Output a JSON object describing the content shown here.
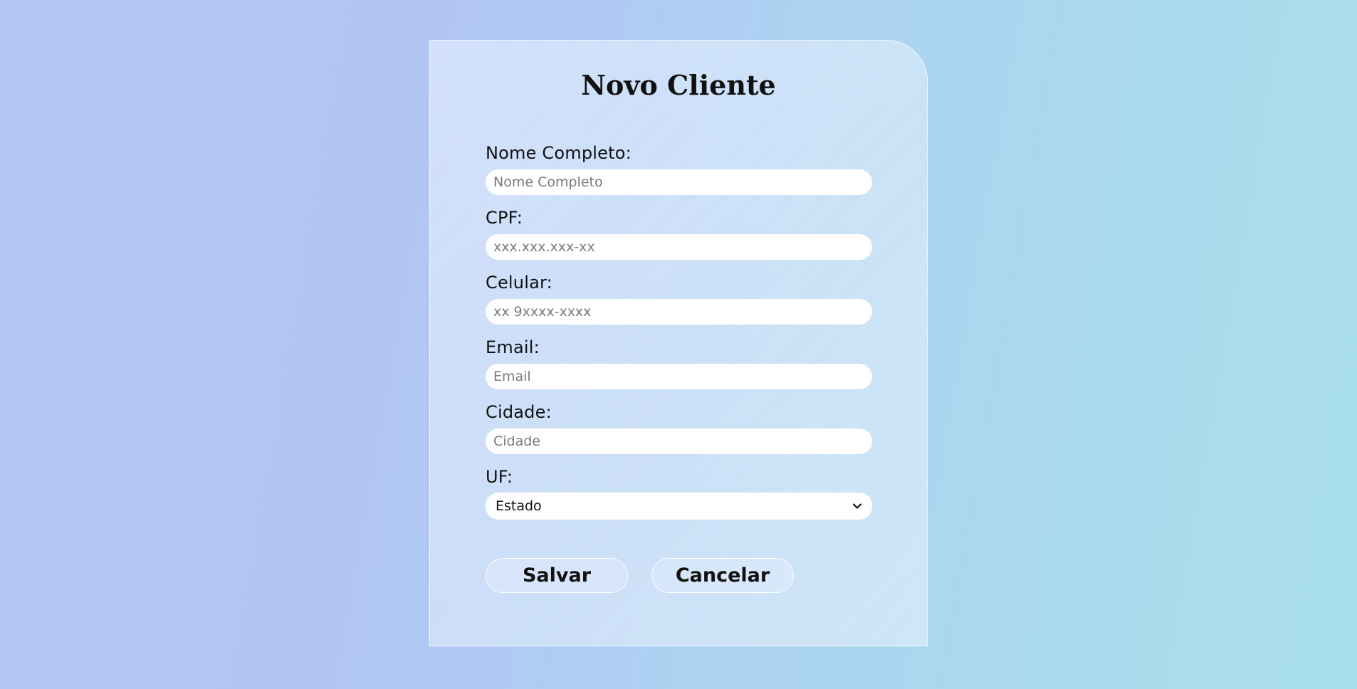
{
  "form": {
    "title": "Novo Cliente",
    "fields": [
      {
        "label": "Nome Completo:",
        "placeholder": "Nome Completo",
        "value": ""
      },
      {
        "label": "CPF:",
        "placeholder": "xxx.xxx.xxx-xx",
        "value": ""
      },
      {
        "label": "Celular:",
        "placeholder": "xx 9xxxx-xxxx",
        "value": ""
      },
      {
        "label": "Email:",
        "placeholder": "Email",
        "value": ""
      },
      {
        "label": "Cidade:",
        "placeholder": "Cidade",
        "value": ""
      }
    ],
    "uf": {
      "label": "UF:",
      "selected": "Estado"
    },
    "buttons": {
      "save": "Salvar",
      "cancel": "Cancelar"
    }
  },
  "icons": {
    "select_arrow": "chevron-down-icon"
  }
}
